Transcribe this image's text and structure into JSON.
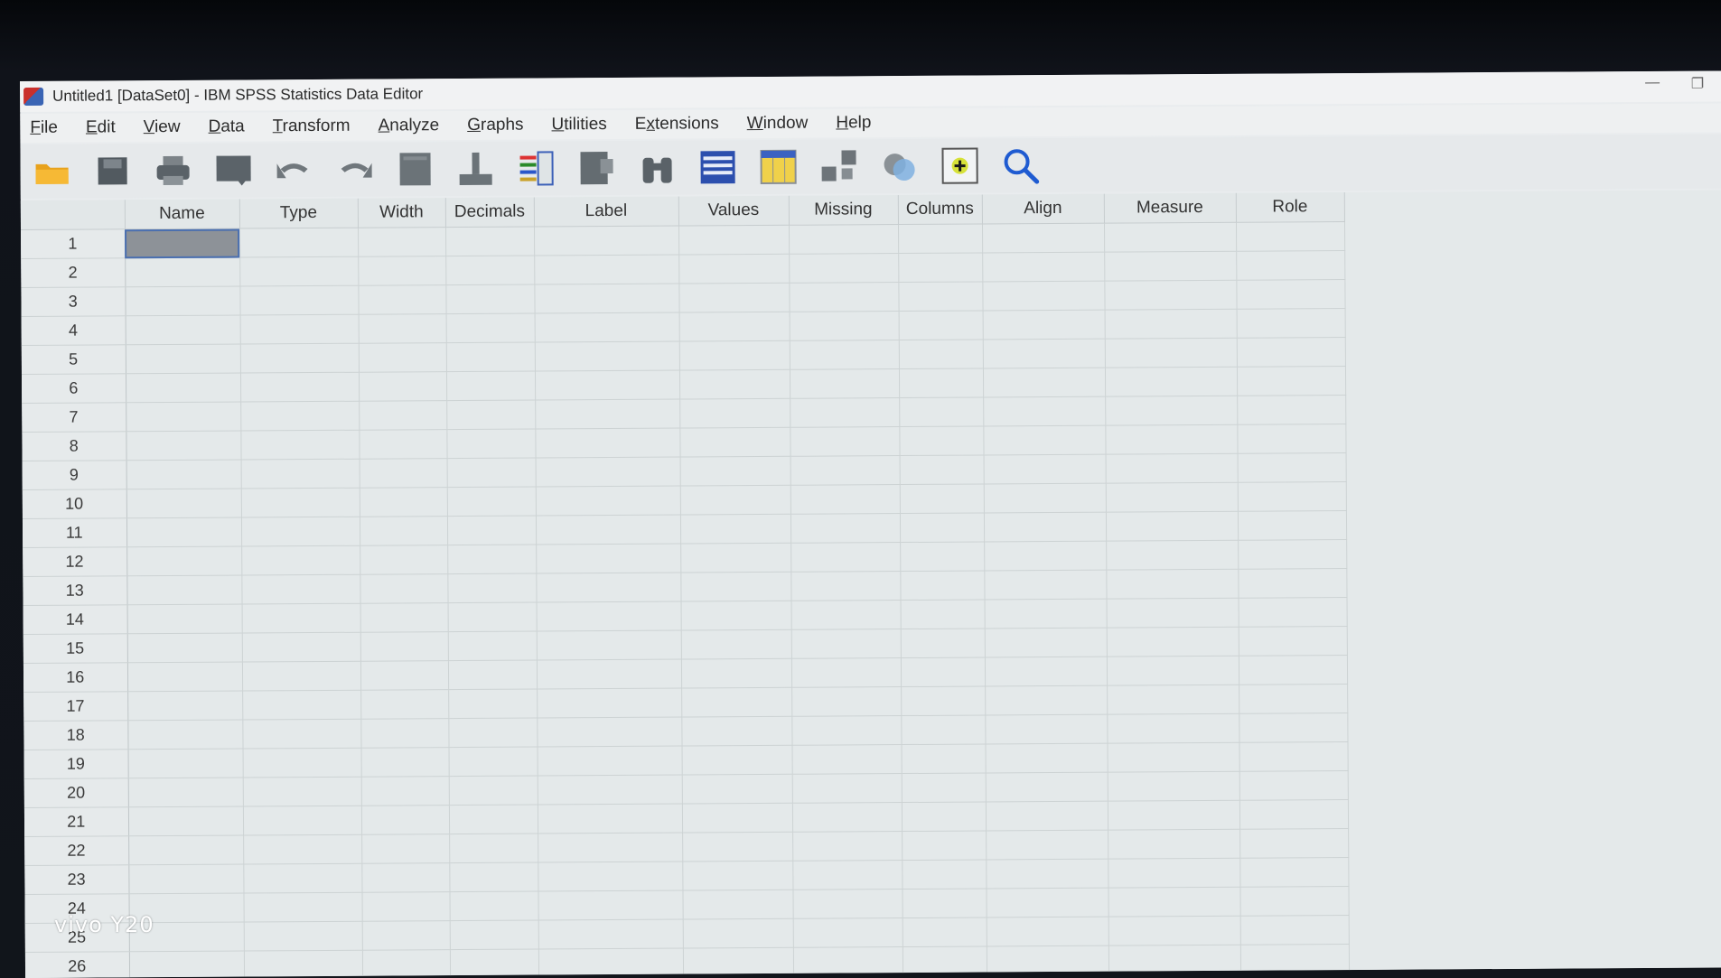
{
  "window": {
    "title": "Untitled1 [DataSet0] - IBM SPSS Statistics Data Editor",
    "minimize": "—",
    "restore": "❐"
  },
  "menu": [
    {
      "label": "File",
      "mnemonic": "F"
    },
    {
      "label": "Edit",
      "mnemonic": "E"
    },
    {
      "label": "View",
      "mnemonic": "V"
    },
    {
      "label": "Data",
      "mnemonic": "D"
    },
    {
      "label": "Transform",
      "mnemonic": "T"
    },
    {
      "label": "Analyze",
      "mnemonic": "A"
    },
    {
      "label": "Graphs",
      "mnemonic": "G"
    },
    {
      "label": "Utilities",
      "mnemonic": "U"
    },
    {
      "label": "Extensions",
      "mnemonic": "x"
    },
    {
      "label": "Window",
      "mnemonic": "W"
    },
    {
      "label": "Help",
      "mnemonic": "H"
    }
  ],
  "toolbar": [
    "open-folder-icon",
    "save-icon",
    "print-icon",
    "recall-dialog-icon",
    "undo-icon",
    "redo-icon",
    "goto-case-icon",
    "goto-variable-icon",
    "variables-icon",
    "run-descriptives-icon",
    "find-icon",
    "insert-cases-icon",
    "insert-variable-icon",
    "split-file-icon",
    "weight-cases-icon",
    "select-cases-icon",
    "value-labels-icon",
    "search-icon"
  ],
  "grid": {
    "columns": [
      "Name",
      "Type",
      "Width",
      "Decimals",
      "Label",
      "Values",
      "Missing",
      "Columns",
      "Align",
      "Measure",
      "Role"
    ],
    "rows": [
      "1",
      "2",
      "3",
      "4",
      "5",
      "6",
      "7",
      "8",
      "9",
      "10",
      "11",
      "12",
      "13",
      "14",
      "15",
      "16",
      "17",
      "18",
      "19",
      "20",
      "21",
      "22",
      "23",
      "24",
      "25",
      "26"
    ],
    "selected_row": 0,
    "selected_col": 0
  },
  "watermark": "vivo Y20"
}
